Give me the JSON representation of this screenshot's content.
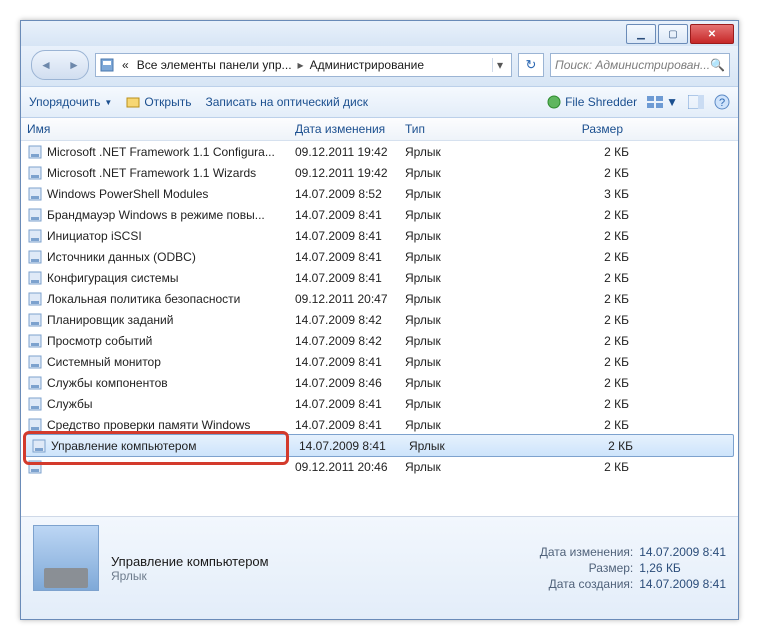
{
  "window_controls": {
    "minimize": "",
    "maximize": "",
    "close": ""
  },
  "breadcrumb": {
    "prefix": "«",
    "seg1": "Все элементы панели упр...",
    "seg2": "Администрирование"
  },
  "search": {
    "placeholder": "Поиск: Администрирован..."
  },
  "toolbar": {
    "organize": "Упорядочить",
    "open": "Открыть",
    "burn": "Записать на оптический диск",
    "shredder": "File Shredder"
  },
  "columns": {
    "name": "Имя",
    "date": "Дата изменения",
    "type": "Тип",
    "size": "Размер"
  },
  "rows": [
    {
      "name": "Microsoft .NET Framework 1.1 Configura...",
      "date": "09.12.2011 19:42",
      "type": "Ярлык",
      "size": "2 КБ"
    },
    {
      "name": "Microsoft .NET Framework 1.1 Wizards",
      "date": "09.12.2011 19:42",
      "type": "Ярлык",
      "size": "2 КБ"
    },
    {
      "name": "Windows PowerShell Modules",
      "date": "14.07.2009 8:52",
      "type": "Ярлык",
      "size": "3 КБ"
    },
    {
      "name": "Брандмауэр Windows в режиме повы...",
      "date": "14.07.2009 8:41",
      "type": "Ярлык",
      "size": "2 КБ"
    },
    {
      "name": "Инициатор iSCSI",
      "date": "14.07.2009 8:41",
      "type": "Ярлык",
      "size": "2 КБ"
    },
    {
      "name": "Источники данных (ODBC)",
      "date": "14.07.2009 8:41",
      "type": "Ярлык",
      "size": "2 КБ"
    },
    {
      "name": "Конфигурация системы",
      "date": "14.07.2009 8:41",
      "type": "Ярлык",
      "size": "2 КБ"
    },
    {
      "name": "Локальная политика безопасности",
      "date": "09.12.2011 20:47",
      "type": "Ярлык",
      "size": "2 КБ"
    },
    {
      "name": "Планировщик заданий",
      "date": "14.07.2009 8:42",
      "type": "Ярлык",
      "size": "2 КБ"
    },
    {
      "name": "Просмотр событий",
      "date": "14.07.2009 8:42",
      "type": "Ярлык",
      "size": "2 КБ"
    },
    {
      "name": "Системный монитор",
      "date": "14.07.2009 8:41",
      "type": "Ярлык",
      "size": "2 КБ"
    },
    {
      "name": "Службы компонентов",
      "date": "14.07.2009 8:46",
      "type": "Ярлык",
      "size": "2 КБ"
    },
    {
      "name": "Службы",
      "date": "14.07.2009 8:41",
      "type": "Ярлык",
      "size": "2 КБ"
    },
    {
      "name": "Средство проверки памяти Windows",
      "date": "14.07.2009 8:41",
      "type": "Ярлык",
      "size": "2 КБ"
    },
    {
      "name": "Управление компьютером",
      "date": "14.07.2009 8:41",
      "type": "Ярлык",
      "size": "2 КБ",
      "selected": true,
      "highlighted": true
    },
    {
      "name": "",
      "date": "09.12.2011 20:46",
      "type": "Ярлык",
      "size": "2 КБ"
    }
  ],
  "details": {
    "title": "Управление компьютером",
    "subtitle": "Ярлык",
    "props": {
      "modified_k": "Дата изменения:",
      "modified_v": "14.07.2009 8:41",
      "size_k": "Размер:",
      "size_v": "1,26 КБ",
      "created_k": "Дата создания:",
      "created_v": "14.07.2009 8:41"
    }
  }
}
